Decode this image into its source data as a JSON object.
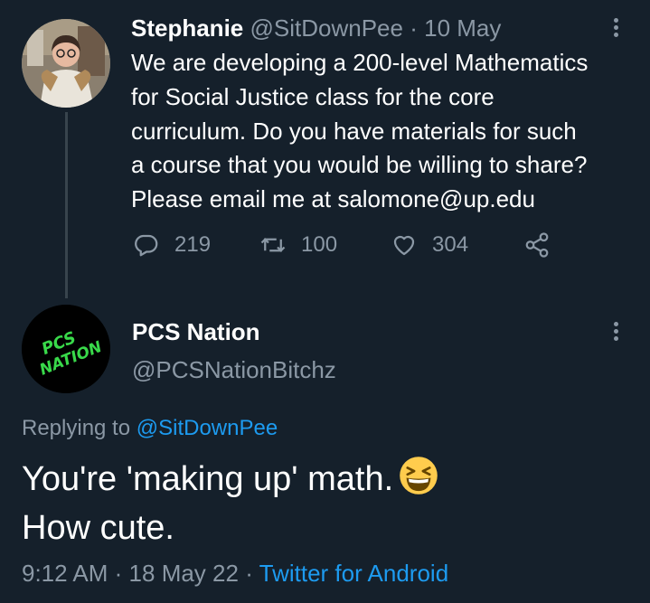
{
  "tweet1": {
    "name": "Stephanie",
    "handle": "@SitDownPee",
    "separator": "·",
    "date": "10 May",
    "text_lines": [
      "We are developing a 200-level Mathematics",
      "for Social Justice class for the core",
      "curriculum. Do you have materials for such",
      "a course that you would be willing to share?",
      "Please email me at salomone@up.edu"
    ],
    "replies": "219",
    "retweets": "100",
    "likes": "304"
  },
  "tweet2": {
    "name": "PCS Nation",
    "handle": "@PCSNationBitchz",
    "avatar_text": [
      "PCS",
      "NATION"
    ],
    "replying_prefix": "Replying to",
    "replying_to": "@SitDownPee",
    "text_lines": [
      "You're 'making up' math.",
      "How cute."
    ],
    "time": "9:12 AM",
    "separator1": "·",
    "date": "18 May 22",
    "separator2": "·",
    "source": "Twitter for Android"
  },
  "colors": {
    "background": "#15202b",
    "text": "#ffffff",
    "muted": "#8b98a5",
    "link": "#1d9bf0",
    "avatar_logo": "#39d94a"
  },
  "icons": [
    "reply-icon",
    "retweet-icon",
    "like-icon",
    "share-icon",
    "more-options-icon",
    "grinning-squinting-face-emoji"
  ]
}
